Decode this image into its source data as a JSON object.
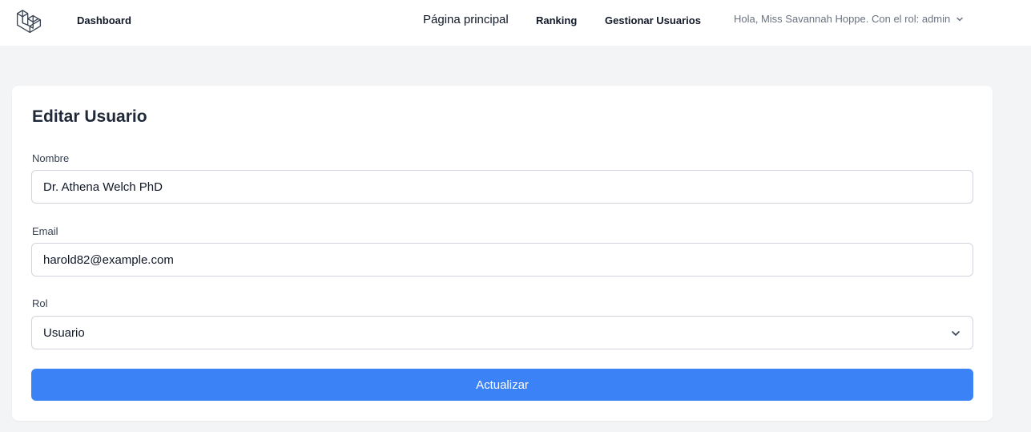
{
  "nav": {
    "logo_icon": "laravel-logo-icon",
    "dashboard": "Dashboard",
    "home": "Página principal",
    "ranking": "Ranking",
    "manage_users": "Gestionar Usuarios",
    "user_greeting": "Hola, Miss Savannah Hoppe. Con el rol: admin",
    "user_menu_icon": "chevron-down-icon"
  },
  "form": {
    "title": "Editar Usuario",
    "name_label": "Nombre",
    "name_value": "Dr. Athena Welch PhD",
    "email_label": "Email",
    "email_value": "harold82@example.com",
    "role_label": "Rol",
    "role_selected": "Usuario",
    "role_icon": "chevron-down-icon",
    "submit_label": "Actualizar"
  },
  "colors": {
    "primary_button": "#3b82f6",
    "page_background": "#f3f4f6",
    "card_background": "#ffffff"
  }
}
